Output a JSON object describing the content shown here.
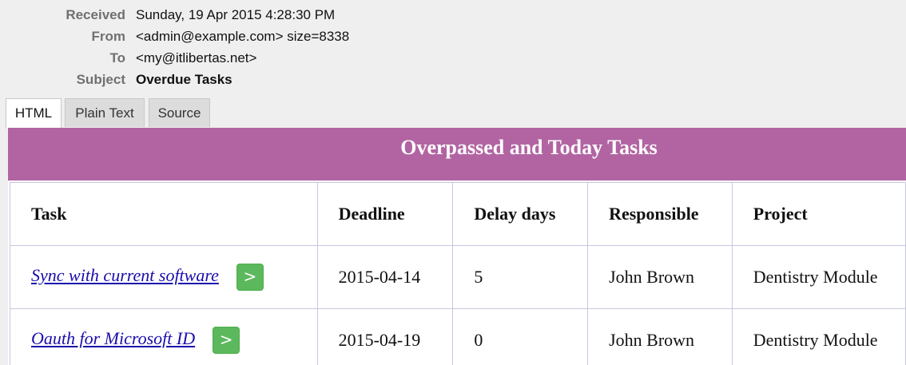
{
  "headers": [
    {
      "label": "Received",
      "value": "Sunday, 19 Apr 2015 4:28:30 PM",
      "bold": false
    },
    {
      "label": "From",
      "value": "<admin@example.com> size=8338",
      "bold": false
    },
    {
      "label": "To",
      "value": "<my@itlibertas.net>",
      "bold": false
    },
    {
      "label": "Subject",
      "value": "Overdue Tasks",
      "bold": true
    }
  ],
  "tabs": [
    {
      "label": "HTML",
      "active": true
    },
    {
      "label": "Plain Text",
      "active": false
    },
    {
      "label": "Source",
      "active": false
    }
  ],
  "email": {
    "banner_title": "Overpassed and Today Tasks",
    "columns": [
      "Task",
      "Deadline",
      "Delay days",
      "Responsible",
      "Project"
    ],
    "rows": [
      {
        "task": "Sync with current software",
        "button": ">",
        "deadline": "2015-04-14",
        "delay": "5",
        "responsible": "John Brown",
        "project": "Dentistry Module"
      },
      {
        "task": "Oauth for Microsoft ID",
        "button": ">",
        "deadline": "2015-04-19",
        "delay": "0",
        "responsible": "John Brown",
        "project": "Dentistry Module"
      }
    ]
  },
  "colors": {
    "banner": "#b264a2",
    "button": "#5cb85c",
    "link": "#1a0dab",
    "header_label": "#707070"
  }
}
